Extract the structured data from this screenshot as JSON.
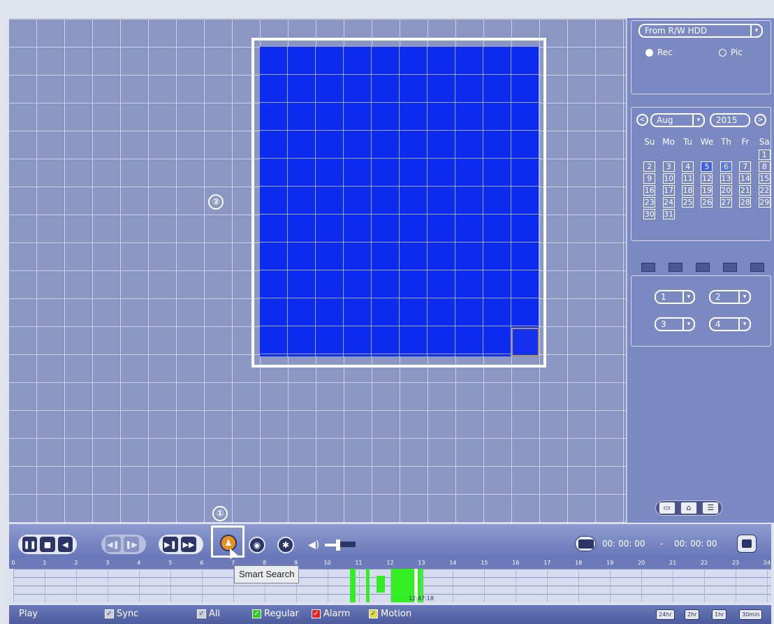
{
  "annotations": {
    "marker1": "①",
    "marker2": "②"
  },
  "right_panel": {
    "source": "From R/W HDD",
    "record_type": {
      "rec": "Rec",
      "pic": "Pic",
      "selected": "Rec"
    },
    "calendar": {
      "prev": "<",
      "next": ">",
      "month": "Aug",
      "year": "2015",
      "weekdays": [
        "Su",
        "Mo",
        "Tu",
        "We",
        "Th",
        "Fr",
        "Sa"
      ],
      "days": [
        "",
        "",
        "",
        "",
        "",
        "",
        "1",
        "2",
        "3",
        "4",
        "5",
        "6",
        "7",
        "8",
        "9",
        "10",
        "11",
        "12",
        "13",
        "14",
        "15",
        "16",
        "17",
        "18",
        "19",
        "20",
        "21",
        "22",
        "23",
        "24",
        "25",
        "26",
        "27",
        "28",
        "29",
        "30",
        "31"
      ],
      "highlighted": [
        "5",
        "6"
      ]
    },
    "channels": [
      "1",
      "2",
      "3",
      "4"
    ]
  },
  "control_bar": {
    "time_start": "00: 00: 00",
    "time_separator": "-",
    "time_end": "00: 00: 00",
    "tooltip": "Smart Search"
  },
  "timeline": {
    "hours": [
      "0",
      "1",
      "2",
      "3",
      "4",
      "5",
      "6",
      "7",
      "8",
      "9",
      "10",
      "11",
      "12",
      "13",
      "14",
      "15",
      "16",
      "17",
      "18",
      "19",
      "20",
      "21",
      "22",
      "23",
      "24"
    ],
    "marker_label": "12:47:18"
  },
  "status_bar": {
    "play": "Play",
    "sync": "Sync",
    "all": "All",
    "regular": "Regular",
    "alarm": "Alarm",
    "motion": "Motion",
    "zoom": [
      "24hr",
      "2hr",
      "1hr",
      "30min"
    ]
  },
  "colors": {
    "grid_bg": "#8b97c3",
    "roi_fill": "#0e2cf0",
    "regular": "#33ee22",
    "alarm": "#e82222",
    "motion": "#e2d84a"
  }
}
